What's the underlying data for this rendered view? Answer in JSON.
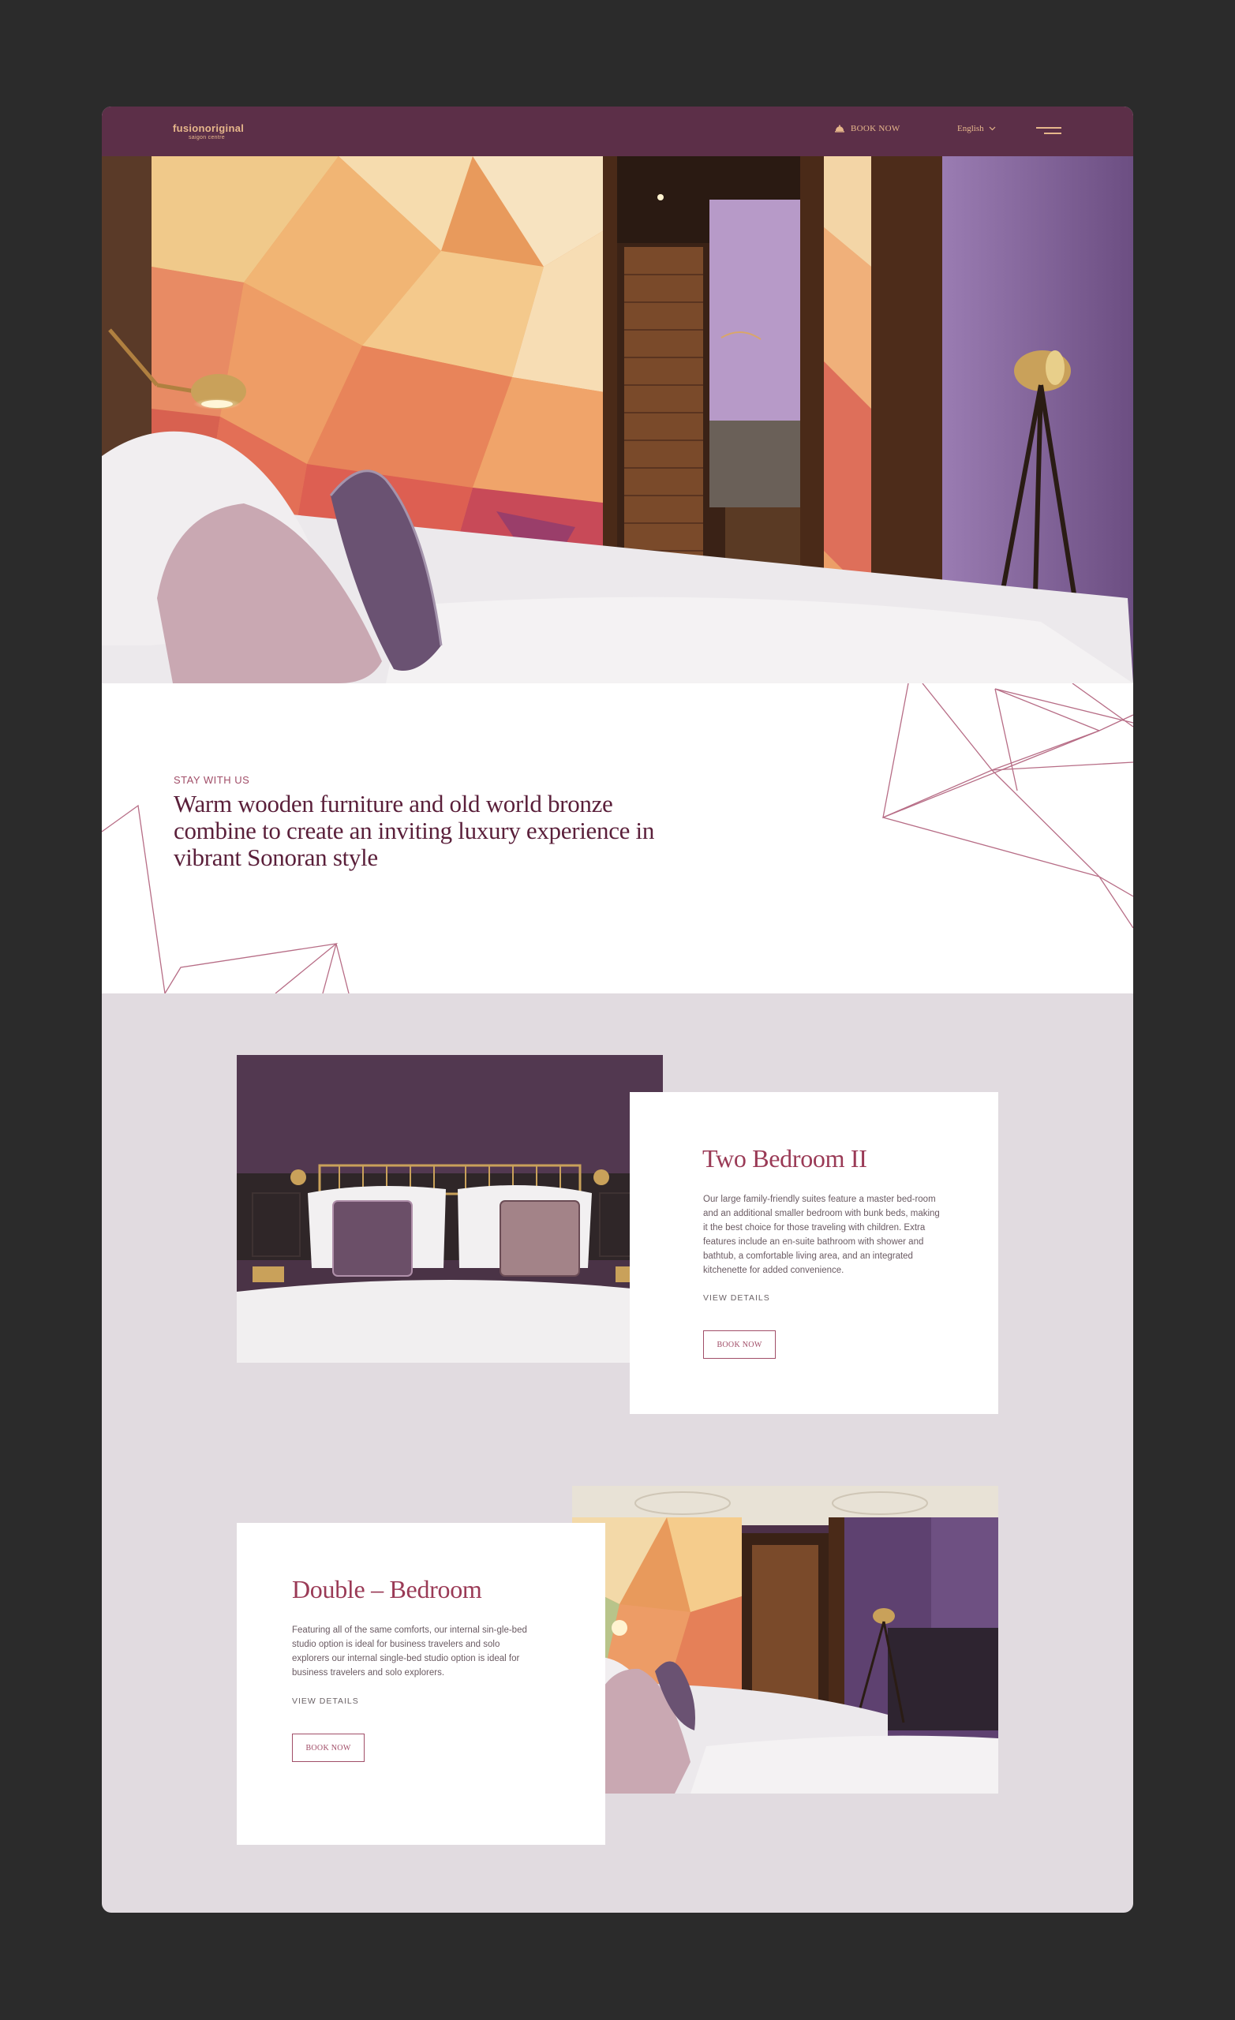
{
  "header": {
    "brand": "fusionoriginal",
    "brand_sub": "saigon centre",
    "book_now": "BOOK NOW",
    "language": "English"
  },
  "intro": {
    "eyebrow": "STAY WITH US",
    "heading": "Warm wooden furniture and old world bronze combine to create an inviting luxury experience in vibrant Sonoran style"
  },
  "rooms": [
    {
      "title": "Two Bedroom II",
      "description": "Our large family-friendly suites feature a master bed-room and an additional smaller bedroom with bunk beds, making it the best choice for those traveling with children. Extra features include an en-suite bathroom with shower and bathtub, a comfortable living area, and an integrated kitchenette for added convenience.",
      "view_details": "VIEW DETAILS",
      "book_now": "BOOK NOW"
    },
    {
      "title": "Double – Bedroom",
      "description": "Featuring all of the same comforts, our internal sin-gle-bed studio option is ideal for business travelers and solo explorers our internal single-bed studio option is ideal for business travelers and solo explorers.",
      "view_details": "VIEW DETAILS",
      "book_now": "BOOK NOW"
    }
  ],
  "colors": {
    "page_bg": "#2b2b2b",
    "header_bg": "#5c2f48",
    "accent_gold": "#e6b78b",
    "accent_rose": "#a14e68",
    "heading_plum": "#5a1f3a",
    "section_lilac": "#e1dbe0"
  },
  "icons": {
    "book": "bell-icon",
    "language": "chevron-down-icon",
    "menu": "hamburger-menu-icon"
  }
}
